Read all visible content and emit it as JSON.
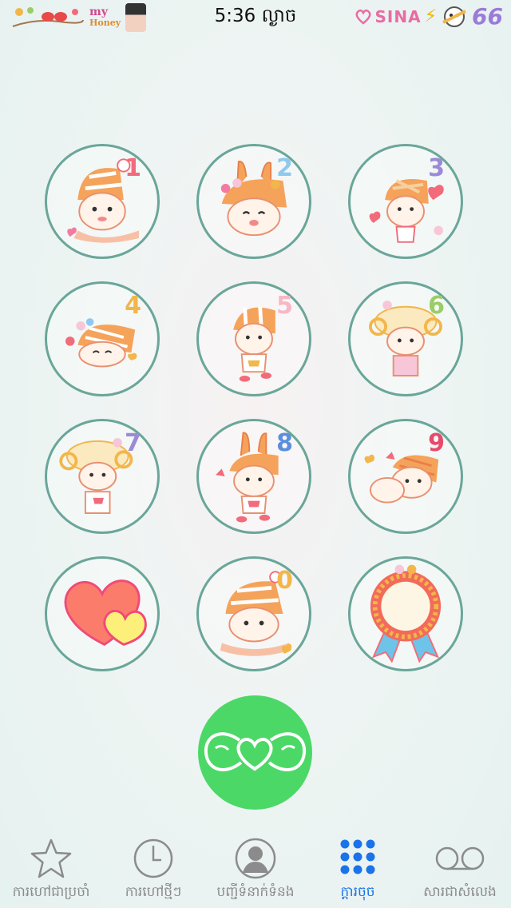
{
  "status_bar": {
    "time": "5:36 ល្ងាច",
    "carrier_logo": "SINA",
    "battery_level": "66",
    "sticker_text": "my",
    "sticker_text_sub": "Honey"
  },
  "keypad": {
    "keys": [
      {
        "digit": "1",
        "color": "#f26b7a",
        "icon": "character-hat-icon"
      },
      {
        "digit": "2",
        "color": "#8ec9ef",
        "icon": "character-bunny-ears-icon"
      },
      {
        "digit": "3",
        "color": "#9b8ad6",
        "icon": "character-hearts-icon"
      },
      {
        "digit": "4",
        "color": "#f2b64a",
        "icon": "character-lying-icon"
      },
      {
        "digit": "5",
        "color": "#f7b7c6",
        "icon": "character-walking-icon"
      },
      {
        "digit": "6",
        "color": "#9ccc65",
        "icon": "character-sheep-icon"
      },
      {
        "digit": "7",
        "color": "#9b8ad6",
        "icon": "character-sheep-icon"
      },
      {
        "digit": "8",
        "color": "#5b8fdd",
        "icon": "character-bunny-icon"
      },
      {
        "digit": "9",
        "color": "#e84a6b",
        "icon": "character-peeking-icon"
      },
      {
        "digit": "",
        "color": "",
        "icon": "heart-icon"
      },
      {
        "digit": "0",
        "color": "#f2b64a",
        "icon": "character-sitting-icon"
      },
      {
        "digit": "",
        "color": "",
        "icon": "badge-ribbon-icon"
      }
    ],
    "key_border_color": "#6aa699"
  },
  "call_button": {
    "color": "#4cd866",
    "icon": "bow-heart-icon"
  },
  "tabs": [
    {
      "label": "ការហៅជាប្រចាំ",
      "icon": "star-icon",
      "active": false
    },
    {
      "label": "ការហៅថ្មីៗ",
      "icon": "clock-icon",
      "active": false
    },
    {
      "label": "បញ្ជីទំនាក់ទំនង",
      "icon": "contact-icon",
      "active": false
    },
    {
      "label": "ក្តារចុច",
      "icon": "keypad-icon",
      "active": true
    },
    {
      "label": "សារជាសំលេង",
      "icon": "voicemail-icon",
      "active": false
    }
  ],
  "accent_color": "#1a73e8"
}
